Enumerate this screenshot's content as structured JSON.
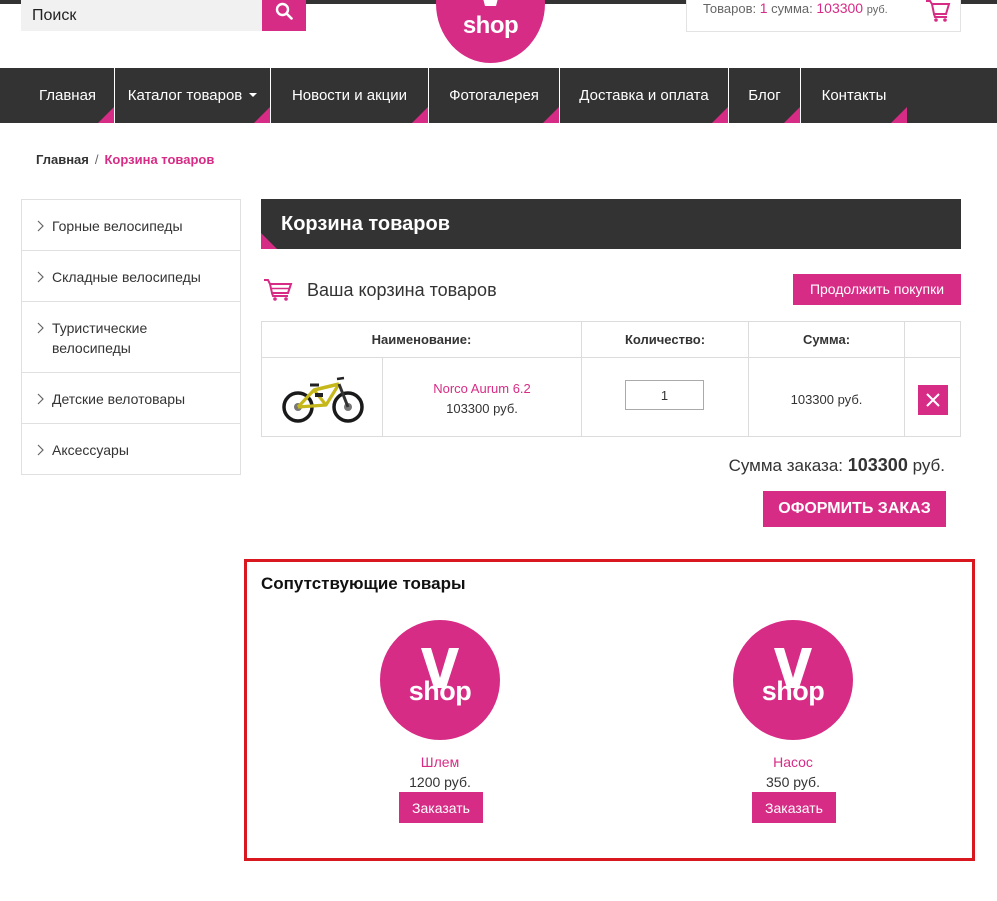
{
  "header": {
    "search": {
      "placeholder": "Поиск",
      "icon": "search-icon"
    },
    "logo_text": "shop",
    "cart": {
      "items_label": "Товаров:",
      "items_count": "1",
      "sum_label": "сумма:",
      "sum_value": "103300",
      "currency": "руб.",
      "icon": "cart-icon"
    }
  },
  "nav": {
    "items": [
      {
        "label": "Главная"
      },
      {
        "label": "Каталог товаров"
      },
      {
        "label": "Новости и акции"
      },
      {
        "label": "Фотогалерея"
      },
      {
        "label": "Доставка и оплата"
      },
      {
        "label": "Блог"
      },
      {
        "label": "Контакты"
      }
    ]
  },
  "breadcrumb": {
    "home": "Главная",
    "separator": "/",
    "current": "Корзина товаров"
  },
  "sidebar": {
    "items": [
      {
        "label": "Горные велосипеды"
      },
      {
        "label": "Складные велосипеды"
      },
      {
        "label": "Туристические велосипеды"
      },
      {
        "label": "Детские велотовары"
      },
      {
        "label": "Аксессуары"
      }
    ]
  },
  "main": {
    "page_title": "Корзина товаров",
    "cart_title": "Ваша корзина товаров",
    "continue_label": "Продолжить покупки",
    "table": {
      "headers": {
        "name": "Наименование:",
        "qty": "Количество:",
        "sum": "Сумма:"
      },
      "rows": [
        {
          "name": "Norco Aurum 6.2",
          "price": "103300 руб.",
          "qty": "1",
          "sum": "103300 руб."
        }
      ]
    },
    "order_total": {
      "label": "Сумма заказа:",
      "value": "103300",
      "currency": "руб."
    },
    "checkout_label": "ОФОРМИТЬ ЗАКАЗ"
  },
  "related": {
    "title": "Сопутствующие товары",
    "items": [
      {
        "logo_text": "shop",
        "name": "Шлем",
        "price": "1200 руб.",
        "button": "Заказать"
      },
      {
        "logo_text": "shop",
        "name": "Насос",
        "price": "350 руб.",
        "button": "Заказать"
      }
    ]
  },
  "colors": {
    "accent": "#d72c85",
    "dark": "#333333",
    "highlight_border": "#d8171f"
  }
}
